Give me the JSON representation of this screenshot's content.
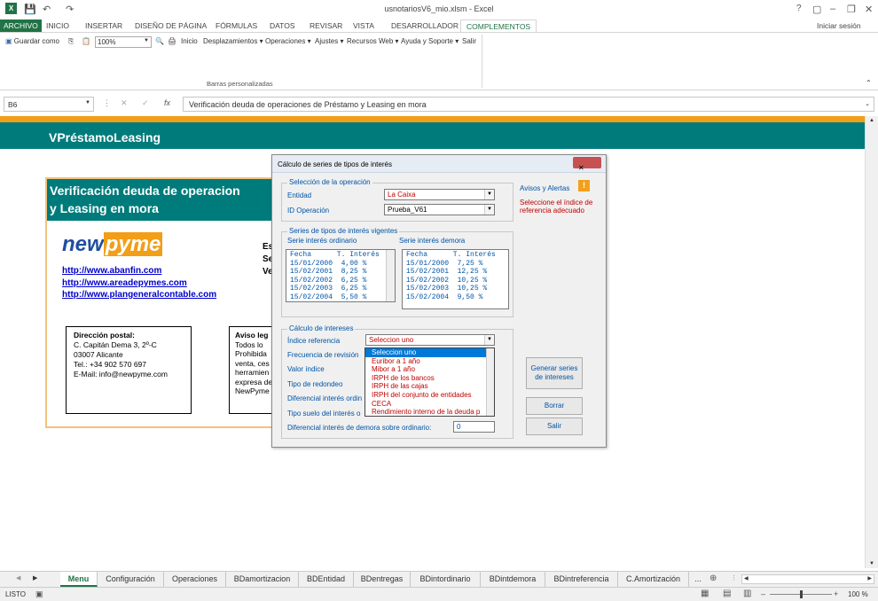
{
  "window": {
    "title": "usnotariosV6_mio.xlsm - Excel",
    "help": "?",
    "signin": "Iniciar sesión"
  },
  "menu": [
    "ARCHIVO",
    "INICIO",
    "INSERTAR",
    "DISEÑO DE PÁGINA",
    "FÓRMULAS",
    "DATOS",
    "REVISAR",
    "VISTA",
    "DESARROLLADOR",
    "COMPLEMENTOS"
  ],
  "ribbon": {
    "save_as": "Guardar como",
    "zoom": "100%",
    "inicio": "Inicio",
    "desplazamientos": "Desplazamientos",
    "operaciones": "Operaciones",
    "ajustes": "Ajustes",
    "recursos": "Recursos Web",
    "ayuda": "Ayuda y Soporte",
    "salir": "Salir",
    "group_label": "Barras personalizadas"
  },
  "formula": {
    "namebox": "B6",
    "content": "Verificación deuda de operaciones de Préstamo y Leasing en mora"
  },
  "sheet": {
    "header": "VPréstamoLeasing",
    "card_title_1": "Verificación deuda de operacion",
    "card_title_2": "y Leasing en mora",
    "logo_new": "new",
    "logo_pyme": "pyme",
    "links": [
      "http://www.abanfin.com",
      "http://www.areadepymes.com",
      "http://www.plangeneralcontable.com"
    ],
    "side_text": [
      "Es",
      "Se",
      "Ve"
    ],
    "address": {
      "title": "Dirección postal:",
      "l1": "C. Capitán Dema 3, 2º-C",
      "l2": "03007 Alicante",
      "l3": "Tel.: +34 902 570 697",
      "l4": "E-Mail: info@newpyme.com"
    },
    "aviso": [
      "Aviso leg",
      "Todos lo",
      "Prohibida",
      "venta, ces",
      "herramien",
      "expresa de",
      "NewPyme"
    ]
  },
  "dialog": {
    "title": "Cálculo de series de tipos de interés",
    "close": "✕",
    "sel_legend": "Selección de la operación",
    "entidad_label": "Entidad",
    "entidad_value": "La Caixa",
    "idop_label": "ID Operación",
    "idop_value": "Prueba_V61",
    "series_legend": "Series de tipos de interés vigentes",
    "ordinario_label": "Serie interés ordinario",
    "demora_label": "Serie interés demora",
    "ordinario_rows": [
      "Fecha      T. Interés",
      "15/01/2000  4,00 %",
      "15/02/2001  8,25 %",
      "15/02/2002  6,25 %",
      "15/02/2003  6,25 %",
      "15/02/2004  5,50 %"
    ],
    "demora_rows": [
      "Fecha      T. Interés",
      "15/01/2000  7,25 %",
      "15/02/2001  12,25 %",
      "15/02/2002  10,25 %",
      "15/02/2003  10,25 %",
      "15/02/2004  9,50 %"
    ],
    "calc_legend": "Cálculo de  intereses",
    "indice_label": "Índice referencia",
    "indice_value": "Seleccion uno",
    "frecuencia_label": "Frecuencia de revisión",
    "valor_label": "Valor índice",
    "redondeo_label": "Tipo de redondeo",
    "diferencial_label": "Diferencial interés ordin",
    "suelo_label": "Tipo suelo del interés o",
    "demora_dif_label": "Diferencial interés de demora sobre ordinario:",
    "demora_dif_value": "0",
    "dropdown": [
      "Seleccion uno",
      "Euribor a 1 año",
      "Mibor a 1 año",
      "IRPH de los bancos",
      "IRPH de las cajas",
      "IRPH del conjunto de entidades",
      "CECA",
      "Rendimiento interno de la deuda p"
    ],
    "avisos_label": "Avisos y Alertas",
    "alert_text_1": "Seleccione el índice de",
    "alert_text_2": "referencia adecuado",
    "btn_generar_1": "Generar series",
    "btn_generar_2": "de intereses",
    "btn_borrar": "Borrar",
    "btn_salir": "Salir"
  },
  "sheet_tabs": [
    "Menu",
    "Configuración",
    "Operaciones",
    "BDamortizacion",
    "BDEntidad",
    "BDentregas",
    "BDintordinario",
    "BDintdemora",
    "BDintreferencia",
    "C.Amortización",
    "..."
  ],
  "status": {
    "mode": "LISTO",
    "zoom": "100 %"
  },
  "colors": {
    "excel_green": "#217346",
    "teal": "#007b7b",
    "orange": "#f29e18",
    "label_blue": "#0054a6",
    "alert_red": "#c00000"
  }
}
